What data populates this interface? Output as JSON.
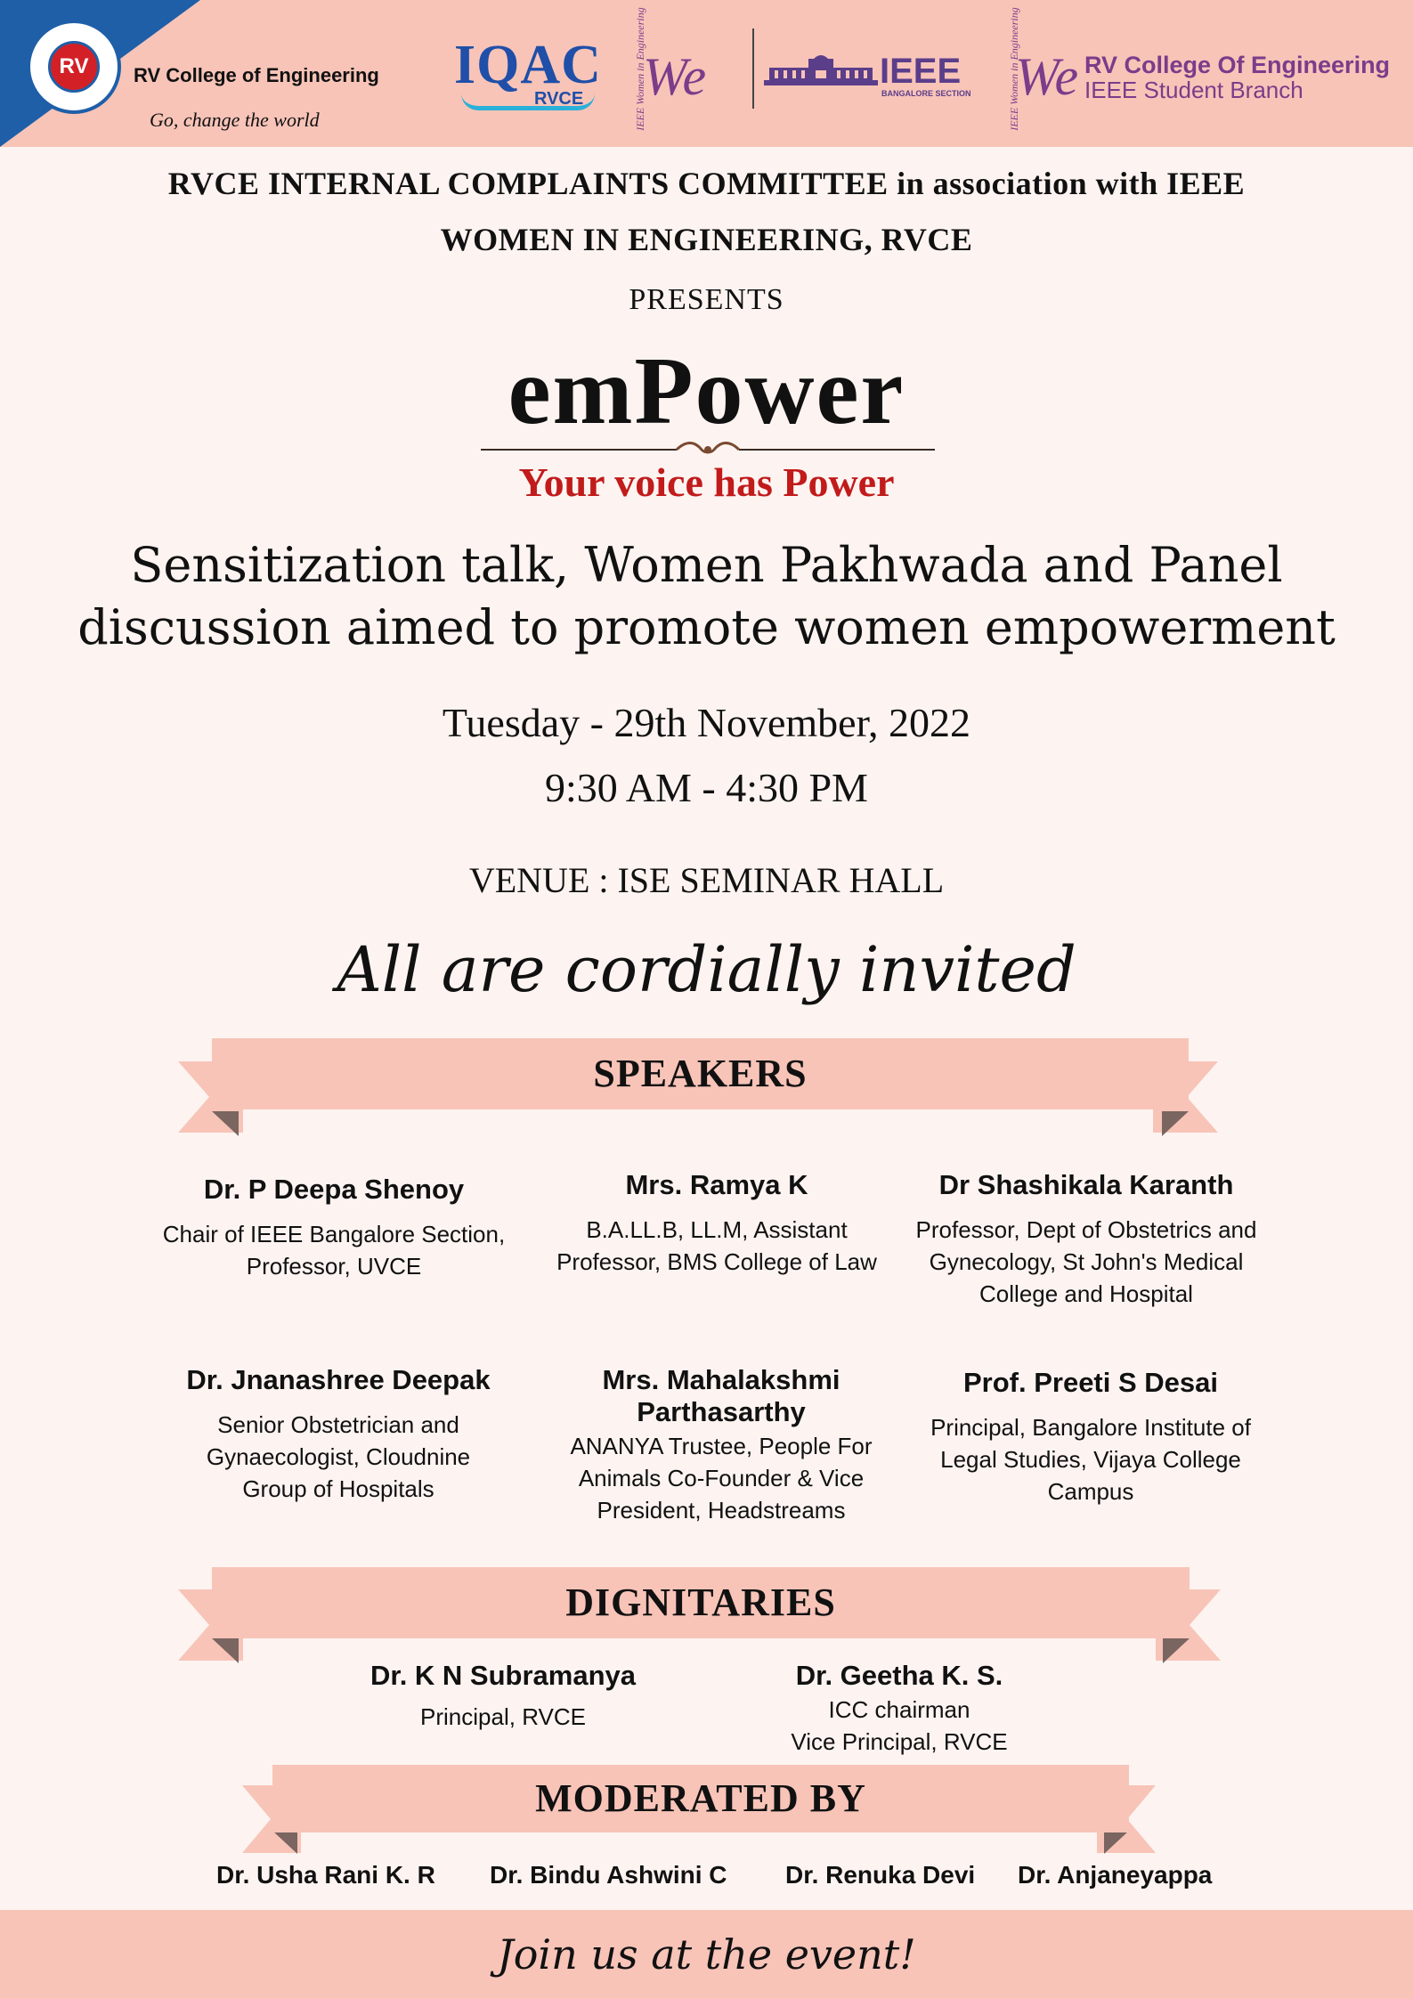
{
  "header": {
    "college_name": "RV College of Engineering",
    "college_tagline": "Go, change the world",
    "seal_text": "RV",
    "iqac_logo": "IQAC",
    "iqac_sub": "RVCE",
    "wie_small": "IEEE Women in Engineering",
    "wie_mark": "We",
    "ieee_logo": "IEEE",
    "ieee_section": "BANGALORE SECTION",
    "branch_name": "RV College Of Engineering",
    "branch_sub": "IEEE Student Branch",
    "colors": {
      "band": "#f8c4b8",
      "corner": "#1f5fa8",
      "purple": "#7b3c8a"
    }
  },
  "organizers": {
    "line1": "RVCE INTERNAL COMPLAINTS COMMITTEE in association with IEEE",
    "line2": "WOMEN IN ENGINEERING, RVCE",
    "presents": "PRESENTS"
  },
  "event": {
    "title": "emPower",
    "tagline": "Your voice has Power",
    "description_line1": "Sensitization talk, Women Pakhwada and Panel",
    "description_line2": "discussion aimed to promote women empowerment",
    "date": "Tuesday - 29th November, 2022",
    "time": "9:30 AM - 4:30 PM",
    "venue": "VENUE : ISE SEMINAR HALL",
    "invitation": "All are cordially invited",
    "tagline_color": "#c11b1b"
  },
  "speakers": {
    "heading": "SPEAKERS",
    "items": [
      {
        "name": "Dr. P Deepa Shenoy",
        "role": "Chair of IEEE Bangalore Section, Professor, UVCE"
      },
      {
        "name": "Mrs. Ramya K",
        "role": "B.A.LL.B, LL.M, Assistant Professor, BMS College of Law"
      },
      {
        "name": "Dr Shashikala Karanth",
        "role": "Professor, Dept of Obstetrics and Gynecology, St John's Medical College and Hospital"
      },
      {
        "name": "Dr. Jnanashree Deepak",
        "role": "Senior Obstetrician and Gynaecologist, Cloudnine Group of Hospitals"
      },
      {
        "name": "Mrs. Mahalakshmi Parthasarthy",
        "role": "ANANYA Trustee, People For Animals Co-Founder & Vice President, Headstreams"
      },
      {
        "name": "Prof. Preeti S Desai",
        "role": "Principal,  Bangalore Institute of Legal Studies, Vijaya College Campus"
      }
    ]
  },
  "dignitaries": {
    "heading": "DIGNITARIES",
    "items": [
      {
        "name": "Dr. K N Subramanya",
        "role_line1": "Principal, RVCE",
        "role_line2": ""
      },
      {
        "name": "Dr. Geetha K. S.",
        "role_line1": "ICC chairman",
        "role_line2": "Vice Principal, RVCE"
      }
    ]
  },
  "moderators": {
    "heading": "MODERATED BY",
    "names": [
      "Dr. Usha Rani K. R",
      "Dr. Bindu Ashwini C",
      "Dr. Renuka Devi",
      "Dr. Anjaneyappa"
    ]
  },
  "footer": {
    "text": "Join us at the event!"
  }
}
